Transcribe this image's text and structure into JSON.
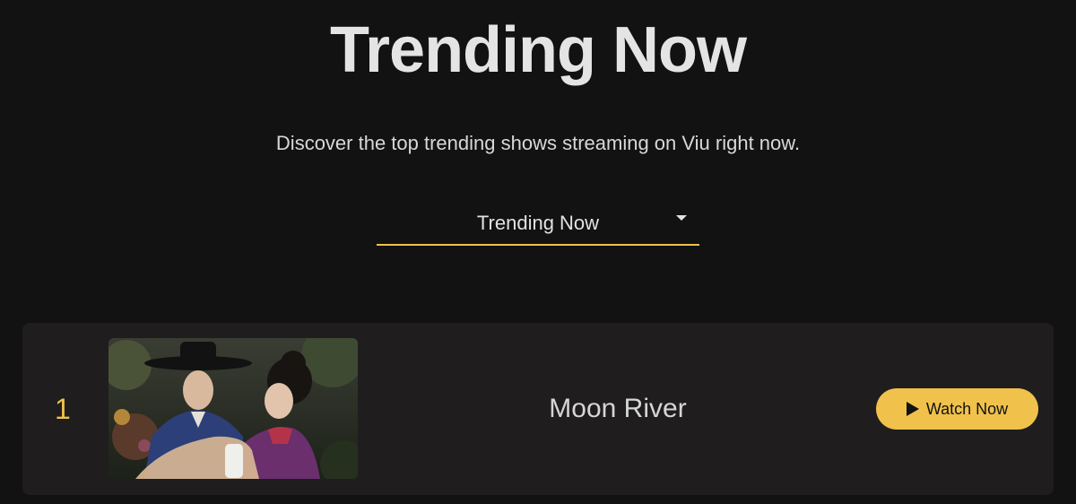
{
  "header": {
    "title": "Trending Now",
    "subtitle": "Discover the top trending shows streaming on Viu right now."
  },
  "filter": {
    "selected": "Trending Now",
    "icon": "chevron-down-icon"
  },
  "shows": [
    {
      "rank": "1",
      "title": "Moon River",
      "thumbnail": "moon-river-thumbnail",
      "action_label": "Watch Now",
      "action_icon": "play-icon"
    }
  ],
  "colors": {
    "background": "#121212",
    "card": "#1f1d1e",
    "accent": "#f0c24b",
    "text": "#e4e4e4"
  }
}
